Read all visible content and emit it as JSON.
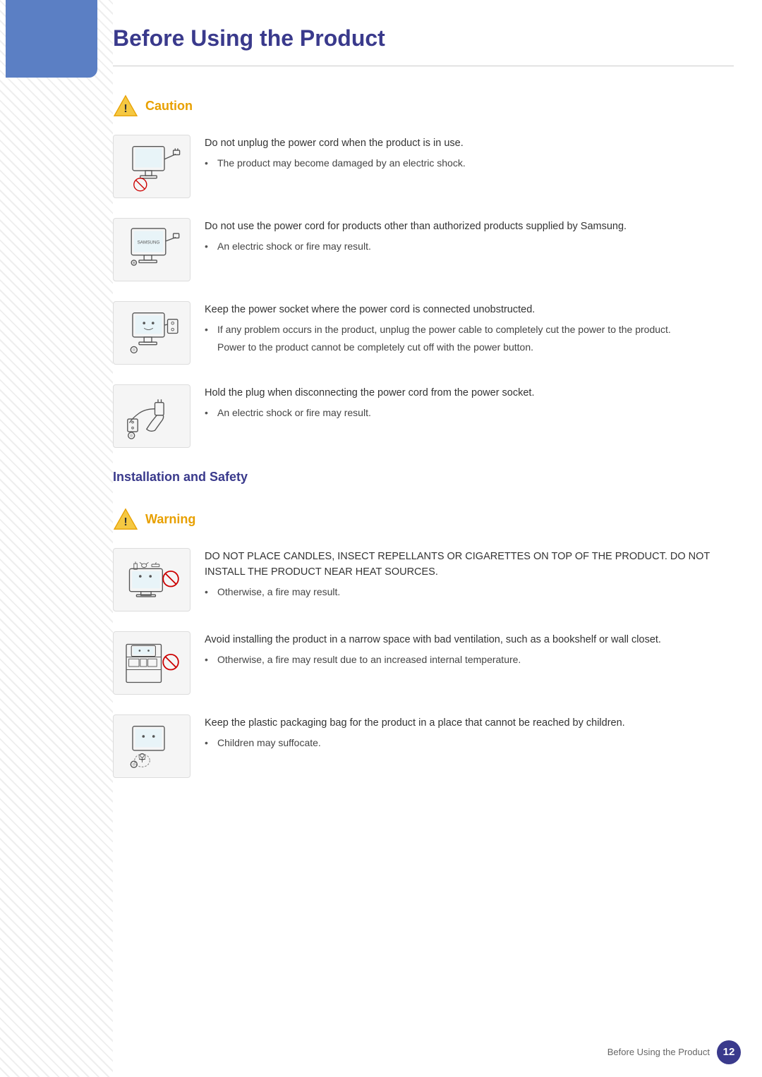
{
  "page": {
    "title": "Before Using the Product",
    "footer_label": "Before Using the Product",
    "page_number": "12"
  },
  "caution_section": {
    "heading": "Caution",
    "items": [
      {
        "id": "caution-1",
        "main_text": "Do not unplug the power cord when the product is in use.",
        "bullets": [
          "The product may become damaged by an electric shock."
        ],
        "sub_texts": []
      },
      {
        "id": "caution-2",
        "main_text": "Do not use the power cord for products other than authorized products supplied by Samsung.",
        "bullets": [
          "An electric shock or fire may result."
        ],
        "sub_texts": []
      },
      {
        "id": "caution-3",
        "main_text": "Keep the power socket where the power cord is connected unobstructed.",
        "bullets": [
          "If any problem occurs in the product, unplug the power cable to completely cut the power to the product."
        ],
        "sub_texts": [
          "Power to the product cannot be completely cut off with the power button."
        ]
      },
      {
        "id": "caution-4",
        "main_text": "Hold the plug when disconnecting the power cord from the power socket.",
        "bullets": [
          "An electric shock or fire may result."
        ],
        "sub_texts": []
      }
    ]
  },
  "install_section": {
    "heading": "Installation and Safety",
    "warning_label": "Warning",
    "items": [
      {
        "id": "warning-1",
        "main_text": "DO NOT PLACE CANDLES, INSECT REPELLANTS OR CIGARETTES ON TOP OF THE PRODUCT. DO NOT INSTALL THE PRODUCT NEAR HEAT SOURCES.",
        "bullets": [
          "Otherwise, a fire may result."
        ],
        "sub_texts": []
      },
      {
        "id": "warning-2",
        "main_text": "Avoid installing the product in a narrow space with bad ventilation, such as a bookshelf or wall closet.",
        "bullets": [
          "Otherwise, a fire may result due to an increased internal temperature."
        ],
        "sub_texts": []
      },
      {
        "id": "warning-3",
        "main_text": "Keep the plastic packaging bag for the product in a place that cannot be reached by children.",
        "bullets": [
          "Children may suffocate."
        ],
        "sub_texts": []
      }
    ]
  }
}
